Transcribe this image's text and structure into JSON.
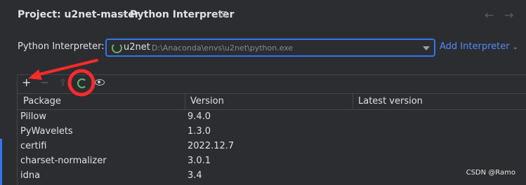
{
  "header": {
    "breadcrumb_root": "Project: u2net-master",
    "breadcrumb_sep": "›",
    "breadcrumb_page": "Python Interpreter",
    "back_icon": "←",
    "forward_icon": "→"
  },
  "interpreter": {
    "label": "Python Interpreter:",
    "name": "u2net",
    "path": "D:\\Anaconda\\envs\\u2net\\python.exe",
    "add_label": "Add Interpreter",
    "add_chevron": "⌄"
  },
  "toolbar": {
    "add_icon": "+",
    "remove_icon": "−",
    "upgrade_icon": "⇧"
  },
  "table": {
    "columns": [
      "Package",
      "Version",
      "Latest version"
    ],
    "rows": [
      {
        "name": "Pillow",
        "version": "9.4.0",
        "latest": ""
      },
      {
        "name": "PyWavelets",
        "version": "1.3.0",
        "latest": ""
      },
      {
        "name": "certifi",
        "version": "2022.12.7",
        "latest": ""
      },
      {
        "name": "charset-normalizer",
        "version": "3.0.1",
        "latest": ""
      },
      {
        "name": "idna",
        "version": "3.4",
        "latest": ""
      }
    ]
  },
  "watermark": "CSDN @Ramo",
  "colors": {
    "background": "#2b2d30",
    "accent": "#3574f0",
    "link": "#548af7",
    "spinner": "#5fb865",
    "annotation": "#ff2a2a"
  }
}
